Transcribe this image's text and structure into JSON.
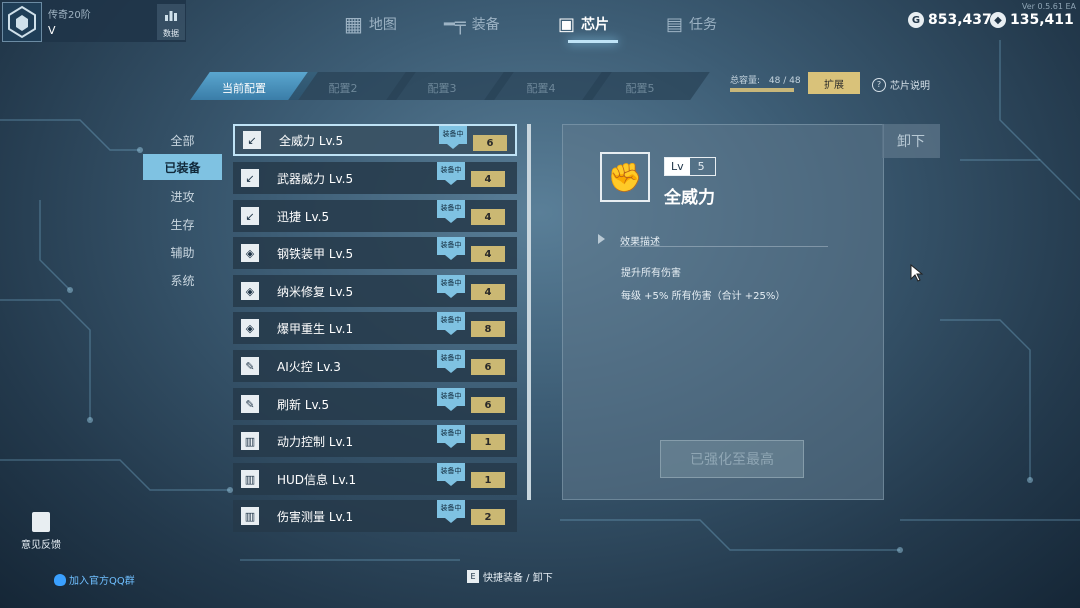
{
  "profile": {
    "rank": "传奇20阶",
    "name": "V",
    "data_label": "数据"
  },
  "nav": [
    {
      "label": "地图",
      "icon": "map-icon"
    },
    {
      "label": "装备",
      "icon": "gun-icon"
    },
    {
      "label": "芯片",
      "icon": "chip-icon",
      "active": true
    },
    {
      "label": "任务",
      "icon": "task-icon"
    }
  ],
  "currency": {
    "gold": "853,437",
    "crystal": "135,411"
  },
  "version": "Ver 0.5.61 EA",
  "configs": [
    "当前配置",
    "配置2",
    "配置3",
    "配置4",
    "配置5"
  ],
  "capacity": {
    "label": "总容量:",
    "value": "48 / 48",
    "fill": 1.0
  },
  "expand_label": "扩展",
  "help_label": "芯片说明",
  "categories": [
    "全部",
    "已装备",
    "进攻",
    "生存",
    "辅助",
    "系统"
  ],
  "active_category": 1,
  "equipped_label": "装备中",
  "chips": [
    {
      "name": "全威力  Lv.5",
      "cost": "6"
    },
    {
      "name": "武器威力  Lv.5",
      "cost": "4"
    },
    {
      "name": "迅捷  Lv.5",
      "cost": "4"
    },
    {
      "name": "钢铁装甲  Lv.5",
      "cost": "4"
    },
    {
      "name": "纳米修复  Lv.5",
      "cost": "4"
    },
    {
      "name": "爆甲重生  Lv.1",
      "cost": "8"
    },
    {
      "name": "AI火控  Lv.3",
      "cost": "6"
    },
    {
      "name": "刷新  Lv.5",
      "cost": "6"
    },
    {
      "name": "动力控制  Lv.1",
      "cost": "1"
    },
    {
      "name": "HUD信息  Lv.1",
      "cost": "1"
    },
    {
      "name": "伤害测量  Lv.1",
      "cost": "2"
    }
  ],
  "detail": {
    "unload_label": "卸下",
    "lv_label": "Lv",
    "level": "5",
    "name": "全威力",
    "section": "效果描述",
    "desc1": "提升所有伤害",
    "desc2": "每级 +5% 所有伤害（合计 +25%）",
    "maxed_label": "已强化至最高"
  },
  "feedback_label": "意见反馈",
  "qq_label": "加入官方QQ群",
  "shortcut": {
    "key": "E",
    "label": "快捷装备 / 卸下"
  }
}
